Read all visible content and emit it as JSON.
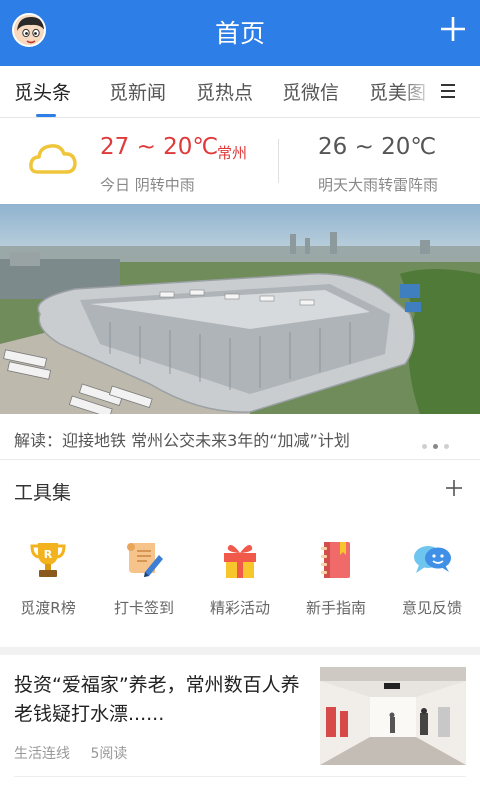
{
  "header": {
    "title": "首页",
    "accent_color": "#2d7ee6",
    "avatar_icon": "avatar-icon",
    "add_icon": "plus-icon"
  },
  "tabs": [
    {
      "label": "觅头条",
      "active": true
    },
    {
      "label": "觅新闻",
      "active": false
    },
    {
      "label": "觅热点",
      "active": false
    },
    {
      "label": "觅微信",
      "active": false
    },
    {
      "label": "觅美图",
      "active": false
    }
  ],
  "tabs_menu_icon": "menu-icon",
  "weather": {
    "today": {
      "temp": "27 ~ 20℃",
      "city": "常州",
      "desc": "今日 阴转中雨",
      "icon": "cloud-icon"
    },
    "tomorrow": {
      "temp": "26 ~ 20℃",
      "desc": "明天大雨转雷阵雨"
    },
    "temp_color": "#e0393a"
  },
  "banner": {
    "caption": "解读：迎接地铁 常州公交未来3年的“加减”计划",
    "dots": 3,
    "active_dot": 2
  },
  "tools": {
    "title": "工具集",
    "add_icon": "plus-icon",
    "items": [
      {
        "label": "觅渡R榜",
        "icon": "trophy-icon"
      },
      {
        "label": "打卡签到",
        "icon": "scroll-pen-icon"
      },
      {
        "label": "精彩活动",
        "icon": "gift-icon"
      },
      {
        "label": "新手指南",
        "icon": "notebook-icon"
      },
      {
        "label": "意见反馈",
        "icon": "chat-bubbles-icon"
      }
    ]
  },
  "news": [
    {
      "title": "投资“爱福家”养老，常州数百人养老钱疑打水漂......",
      "source": "生活连线",
      "reads": "5阅读"
    }
  ]
}
